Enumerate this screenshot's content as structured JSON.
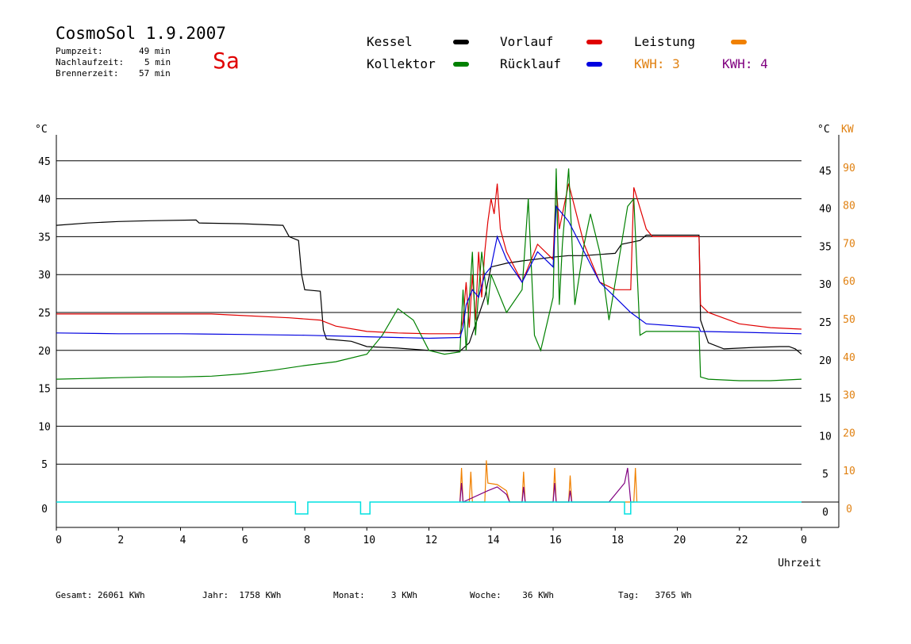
{
  "header": {
    "title": "CosmoSol 1.9.2007",
    "day": "Sa",
    "stats": [
      {
        "label": "Pumpzeit:",
        "value": "49 min"
      },
      {
        "label": "Nachlaufzeit:",
        "value": "5 min"
      },
      {
        "label": "Brennerzeit:",
        "value": "57 min"
      }
    ]
  },
  "legend": {
    "kessel": {
      "label": "Kessel",
      "color": "#000000"
    },
    "vorlauf": {
      "label": "Vorlauf",
      "color": "#e00000"
    },
    "leistung": {
      "label": "Leistung",
      "color": "#f08000"
    },
    "kollektor": {
      "label": "Kollektor",
      "color": "#008000"
    },
    "ruecklauf": {
      "label": "Rücklauf",
      "color": "#0000e0"
    },
    "kwh1": {
      "label": "KWH: 3",
      "color": "#e08010"
    },
    "kwh2": {
      "label": "KWH: 4",
      "color": "#800080"
    }
  },
  "footer": {
    "gesamt": {
      "label": "Gesamt:",
      "value": "26061 KWh"
    },
    "jahr": {
      "label": "Jahr:",
      "value": "1758 KWh"
    },
    "monat": {
      "label": "Monat:",
      "value": "3 KWh"
    },
    "woche": {
      "label": "Woche:",
      "value": "36 KWh"
    },
    "tag": {
      "label": "Tag:",
      "value": "3765 Wh"
    }
  },
  "chart_data": {
    "type": "line",
    "xlabel": "Uhrzeit",
    "ylabel_left": "°C",
    "ylabel_right_temp": "°C",
    "ylabel_right_power": "KW",
    "xlim": [
      0,
      24
    ],
    "ylim": [
      0,
      45
    ],
    "ylim_power": [
      0,
      90
    ],
    "x_ticks": [
      "0",
      "2",
      "4",
      "6",
      "8",
      "10",
      "12",
      "14",
      "16",
      "18",
      "20",
      "22",
      "0"
    ],
    "y_ticks": [
      0,
      5,
      10,
      15,
      20,
      25,
      30,
      35,
      40,
      45
    ],
    "y_ticks_power": [
      0,
      10,
      20,
      30,
      40,
      50,
      60,
      70,
      80,
      90
    ],
    "grid": true,
    "series": [
      {
        "name": "Kessel",
        "color": "#000000",
        "points": [
          [
            0,
            36.5
          ],
          [
            1,
            36.8
          ],
          [
            2,
            37
          ],
          [
            3,
            37.1
          ],
          [
            4.5,
            37.2
          ],
          [
            4.6,
            36.8
          ],
          [
            6,
            36.7
          ],
          [
            7.3,
            36.5
          ],
          [
            7.5,
            35
          ],
          [
            7.8,
            34.5
          ],
          [
            7.9,
            30
          ],
          [
            8,
            28
          ],
          [
            8.5,
            27.8
          ],
          [
            8.6,
            22.7
          ],
          [
            8.7,
            21.5
          ],
          [
            9.5,
            21.2
          ],
          [
            10,
            20.5
          ],
          [
            11,
            20.3
          ],
          [
            12,
            20.0
          ],
          [
            13,
            19.9
          ],
          [
            13.3,
            21
          ],
          [
            13.8,
            27
          ],
          [
            14,
            31
          ],
          [
            14.5,
            31.5
          ],
          [
            15,
            31.8
          ],
          [
            16,
            32.3
          ],
          [
            16.5,
            32.5
          ],
          [
            17,
            32.5
          ],
          [
            18,
            32.8
          ],
          [
            18.2,
            34
          ],
          [
            18.8,
            34.5
          ],
          [
            19,
            35.2
          ],
          [
            20.7,
            35.2
          ],
          [
            20.75,
            24
          ],
          [
            21,
            21
          ],
          [
            21.5,
            20.2
          ],
          [
            22.5,
            20.4
          ],
          [
            23.3,
            20.5
          ],
          [
            23.6,
            20.5
          ],
          [
            23.8,
            20.2
          ],
          [
            24,
            19.5
          ]
        ]
      },
      {
        "name": "Vorlauf",
        "color": "#e00000",
        "points": [
          [
            0,
            24.8
          ],
          [
            2,
            24.8
          ],
          [
            4,
            24.8
          ],
          [
            5,
            24.8
          ],
          [
            5.5,
            24.7
          ],
          [
            7.5,
            24.3
          ],
          [
            8.5,
            24.0
          ],
          [
            9,
            23.2
          ],
          [
            10,
            22.5
          ],
          [
            11,
            22.3
          ],
          [
            12,
            22.2
          ],
          [
            13,
            22.2
          ],
          [
            13.1,
            24
          ],
          [
            13.2,
            29
          ],
          [
            13.3,
            23
          ],
          [
            13.4,
            30
          ],
          [
            13.5,
            24
          ],
          [
            13.6,
            33
          ],
          [
            13.7,
            27
          ],
          [
            13.8,
            33
          ],
          [
            13.9,
            37
          ],
          [
            14,
            40
          ],
          [
            14.1,
            38
          ],
          [
            14.2,
            42
          ],
          [
            14.3,
            36
          ],
          [
            14.5,
            33
          ],
          [
            15,
            29
          ],
          [
            15.5,
            34
          ],
          [
            16,
            32
          ],
          [
            16.1,
            42
          ],
          [
            16.2,
            36
          ],
          [
            16.5,
            42
          ],
          [
            17,
            34
          ],
          [
            17.5,
            29
          ],
          [
            18,
            28
          ],
          [
            18.5,
            28
          ],
          [
            18.6,
            41.5
          ],
          [
            19,
            36
          ],
          [
            19.2,
            35
          ],
          [
            20.7,
            35
          ],
          [
            20.75,
            26
          ],
          [
            21,
            25
          ],
          [
            22,
            23.5
          ],
          [
            23,
            23
          ],
          [
            24,
            22.8
          ]
        ]
      },
      {
        "name": "Kollektor",
        "color": "#008000",
        "points": [
          [
            0,
            16.2
          ],
          [
            1,
            16.3
          ],
          [
            2,
            16.4
          ],
          [
            3,
            16.5
          ],
          [
            4,
            16.5
          ],
          [
            5,
            16.6
          ],
          [
            6,
            16.9
          ],
          [
            7,
            17.4
          ],
          [
            8,
            18.0
          ],
          [
            9,
            18.5
          ],
          [
            10,
            19.5
          ],
          [
            10.5,
            22
          ],
          [
            11,
            25.5
          ],
          [
            11.5,
            24
          ],
          [
            12,
            20
          ],
          [
            12.5,
            19.5
          ],
          [
            13,
            19.8
          ],
          [
            13.1,
            28
          ],
          [
            13.2,
            20
          ],
          [
            13.4,
            33
          ],
          [
            13.5,
            22
          ],
          [
            13.7,
            33
          ],
          [
            13.9,
            26
          ],
          [
            14,
            30
          ],
          [
            14.2,
            28
          ],
          [
            14.5,
            25
          ],
          [
            15,
            28
          ],
          [
            15.2,
            40
          ],
          [
            15.4,
            22
          ],
          [
            15.6,
            20
          ],
          [
            16,
            27
          ],
          [
            16.1,
            44
          ],
          [
            16.2,
            26
          ],
          [
            16.3,
            34
          ],
          [
            16.5,
            44
          ],
          [
            16.7,
            26
          ],
          [
            17,
            34
          ],
          [
            17.2,
            38
          ],
          [
            17.5,
            33
          ],
          [
            17.8,
            24
          ],
          [
            18,
            29
          ],
          [
            18.4,
            39
          ],
          [
            18.6,
            40
          ],
          [
            18.8,
            22
          ],
          [
            19,
            22.5
          ],
          [
            20.7,
            22.5
          ],
          [
            20.75,
            16.5
          ],
          [
            21,
            16.2
          ],
          [
            22,
            16
          ],
          [
            23,
            16
          ],
          [
            24,
            16.2
          ]
        ]
      },
      {
        "name": "Rücklauf",
        "color": "#0000e0",
        "points": [
          [
            0,
            22.3
          ],
          [
            2,
            22.2
          ],
          [
            4,
            22.2
          ],
          [
            6,
            22.1
          ],
          [
            8,
            22.0
          ],
          [
            10,
            21.8
          ],
          [
            12,
            21.6
          ],
          [
            13,
            21.7
          ],
          [
            13.1,
            23
          ],
          [
            13.2,
            26
          ],
          [
            13.4,
            28
          ],
          [
            13.6,
            27
          ],
          [
            13.8,
            30
          ],
          [
            14,
            31
          ],
          [
            14.2,
            35
          ],
          [
            14.5,
            32
          ],
          [
            15,
            29
          ],
          [
            15.5,
            33
          ],
          [
            16,
            31
          ],
          [
            16.1,
            39
          ],
          [
            16.5,
            37
          ],
          [
            17,
            33
          ],
          [
            17.5,
            29
          ],
          [
            18,
            27
          ],
          [
            18.5,
            25
          ],
          [
            19,
            23.5
          ],
          [
            20.7,
            23
          ],
          [
            20.75,
            22.5
          ],
          [
            22,
            22.4
          ],
          [
            24,
            22.2
          ]
        ]
      },
      {
        "name": "Leistung",
        "color": "#f08000",
        "axis": "power",
        "points": [
          [
            13,
            0
          ],
          [
            13.05,
            9
          ],
          [
            13.1,
            0
          ],
          [
            13.3,
            0
          ],
          [
            13.35,
            8
          ],
          [
            13.4,
            0
          ],
          [
            13.8,
            0
          ],
          [
            13.85,
            11
          ],
          [
            13.9,
            5
          ],
          [
            14.2,
            4.6
          ],
          [
            14.5,
            3
          ],
          [
            14.6,
            0
          ],
          [
            15,
            0
          ],
          [
            15.05,
            8
          ],
          [
            15.1,
            0
          ],
          [
            16,
            0
          ],
          [
            16.05,
            9
          ],
          [
            16.1,
            0
          ],
          [
            16.5,
            0
          ],
          [
            16.55,
            7
          ],
          [
            16.6,
            0
          ],
          [
            18.6,
            0
          ],
          [
            18.65,
            9
          ],
          [
            18.7,
            0
          ]
        ]
      },
      {
        "name": "KWH 4",
        "color": "#800080",
        "axis": "power",
        "points": [
          [
            13,
            0
          ],
          [
            13.05,
            5
          ],
          [
            13.1,
            0
          ],
          [
            13.9,
            3
          ],
          [
            14.2,
            4
          ],
          [
            14.5,
            2
          ],
          [
            14.6,
            0
          ],
          [
            15,
            0
          ],
          [
            15.05,
            4
          ],
          [
            15.1,
            0
          ],
          [
            16,
            0
          ],
          [
            16.05,
            5
          ],
          [
            16.1,
            0
          ],
          [
            16.5,
            0
          ],
          [
            16.55,
            3
          ],
          [
            16.6,
            0
          ],
          [
            17.8,
            0
          ],
          [
            18.3,
            5
          ],
          [
            18.4,
            9
          ],
          [
            18.5,
            0
          ]
        ]
      },
      {
        "name": "Pumpe",
        "color": "#00e0e0",
        "axis": "state",
        "points": [
          [
            0,
            0
          ],
          [
            7.7,
            0
          ],
          [
            7.7,
            -3
          ],
          [
            8.1,
            -3
          ],
          [
            8.1,
            0
          ],
          [
            9.8,
            0
          ],
          [
            9.8,
            -3
          ],
          [
            10.1,
            -3
          ],
          [
            10.1,
            0
          ],
          [
            18.3,
            0
          ],
          [
            18.3,
            -3
          ],
          [
            18.5,
            -3
          ],
          [
            18.5,
            0
          ],
          [
            24,
            0
          ]
        ]
      }
    ]
  }
}
